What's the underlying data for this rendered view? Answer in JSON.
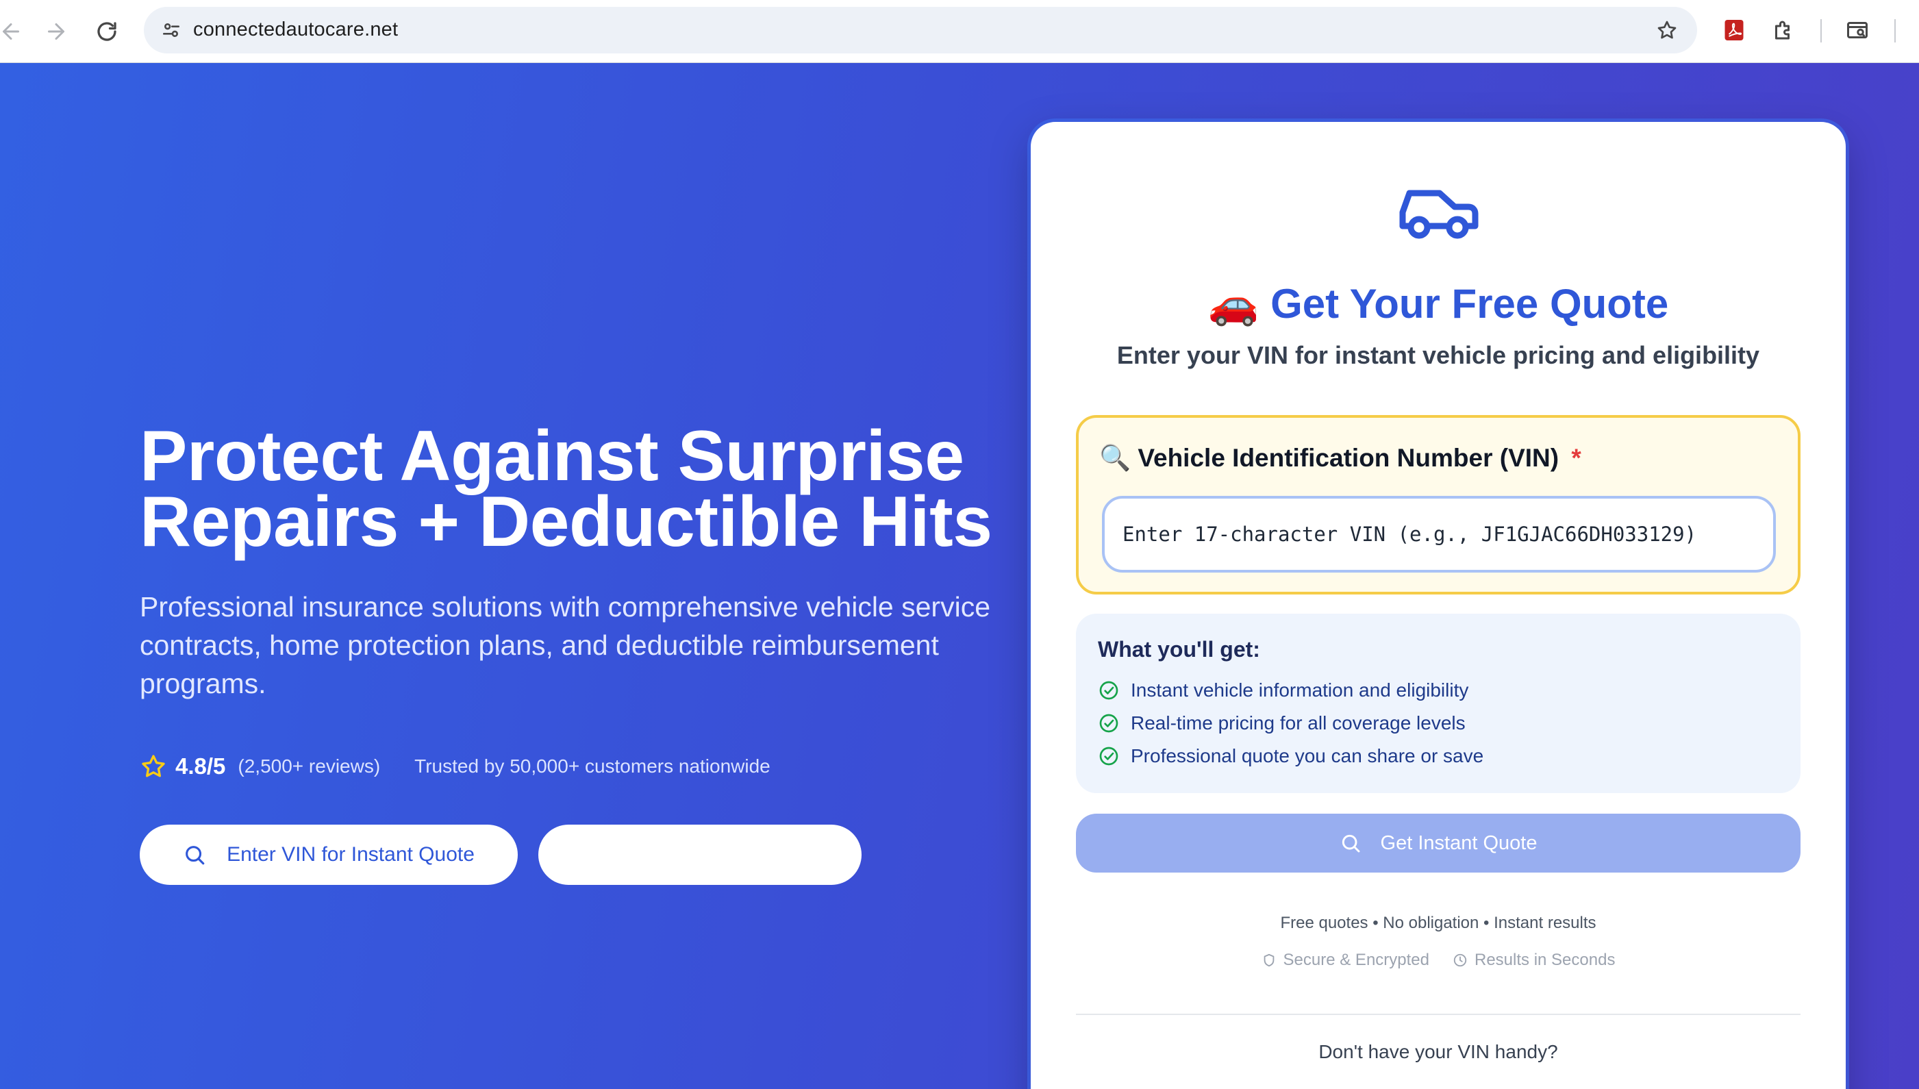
{
  "browser": {
    "url": "connectedautocare.net"
  },
  "hero": {
    "title_line1": "Protect Against Surprise",
    "title_line2": "Repairs + Deductible Hits",
    "subtitle": "Professional insurance solutions with comprehensive vehicle service contracts, home protection plans, and deductible reimbursement programs.",
    "rating_value": "4.8/5",
    "rating_count": "(2,500+ reviews)",
    "trusted": "Trusted by 50,000+ customers nationwide",
    "cta_primary": "Enter VIN for Instant Quote",
    "cta_secondary": ""
  },
  "quote_card": {
    "title": "🚗 Get Your Free Quote",
    "subtitle": "Enter your VIN for instant vehicle pricing and eligibility",
    "vin_label_icon": "🔍",
    "vin_label": "Vehicle Identification Number (VIN)",
    "vin_required_mark": "*",
    "vin_value": "",
    "vin_placeholder": "Enter 17-character VIN (e.g., JF1GJAC66DH033129)",
    "benefits_title": "What you'll get:",
    "benefits": [
      "Instant vehicle information and eligibility",
      "Real-time pricing for all coverage levels",
      "Professional quote you can share or save"
    ],
    "submit_label": "Get Instant Quote",
    "fineprint": "Free quotes • No obligation • Instant results",
    "trust_secure": "Secure & Encrypted",
    "trust_speed": "Results in Seconds",
    "no_vin_prompt": "Don't have your VIN handy?"
  },
  "colors": {
    "accent": "#2f57d8",
    "hero_gradient_start": "#3360e2",
    "hero_gradient_end": "#4a3fc8",
    "vin_box_border": "#f5cc48",
    "submit_disabled": "#98aef0",
    "check_green": "#16a34a",
    "star_yellow": "#facc15"
  }
}
